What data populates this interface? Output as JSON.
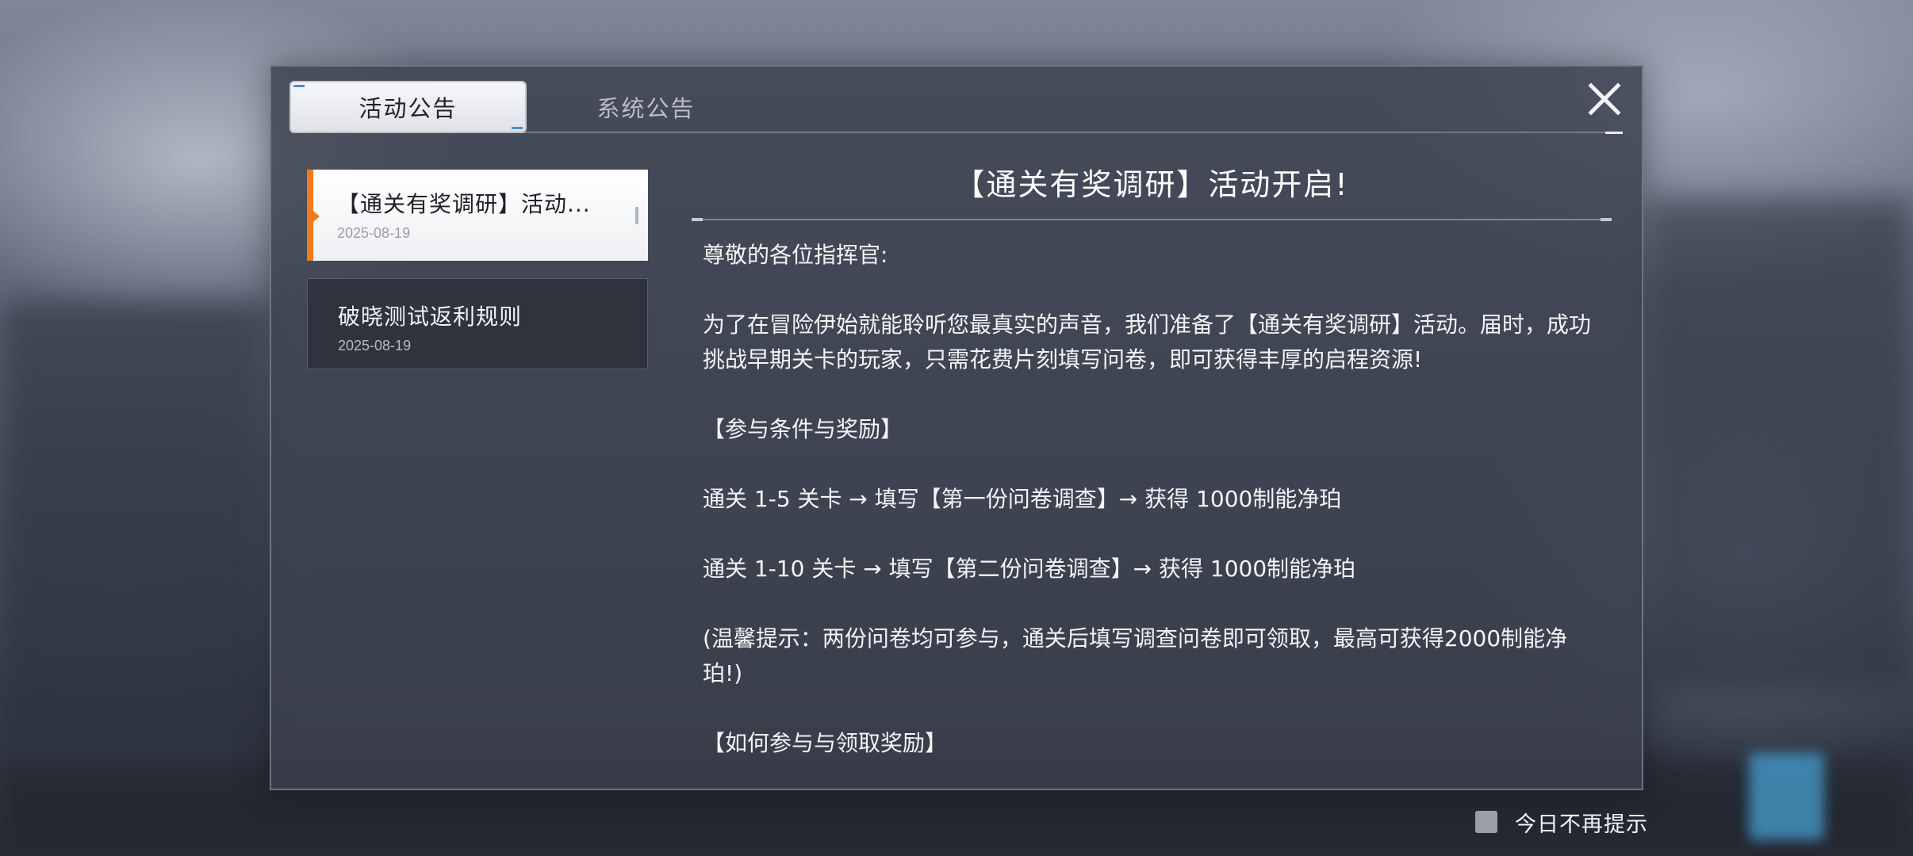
{
  "tabs": {
    "active_label": "活动公告",
    "inactive_label": "系统公告"
  },
  "list": [
    {
      "title": "【通关有奖调研】活动...",
      "date": "2025-08-19",
      "selected": true
    },
    {
      "title": "破晓测试返利规则",
      "date": "2025-08-19",
      "selected": false
    }
  ],
  "content": {
    "title": "【通关有奖调研】活动开启!",
    "paragraphs": [
      "尊敬的各位指挥官:",
      "为了在冒险伊始就能聆听您最真实的声音，我们准备了【通关有奖调研】活动。届时，成功挑战早期关卡的玩家，只需花费片刻填写问卷，即可获得丰厚的启程资源!",
      "【参与条件与奖励】",
      "通关 1-5 关卡 → 填写【第一份问卷调查】→ 获得 1000制能净珀",
      "通关 1-10 关卡 → 填写【第二份问卷调查】→ 获得 1000制能净珀",
      "(温馨提示：两份问卷均可参与，通关后填写调查问卷即可领取，最高可获得2000制能净珀!)",
      "【如何参与与领取奖励】"
    ]
  },
  "footer": {
    "dont_show_today": "今日不再提示"
  },
  "icons": {
    "close": "close-icon"
  },
  "colors": {
    "accent": "#f07a22",
    "tab_marker": "#4d8fcf"
  }
}
